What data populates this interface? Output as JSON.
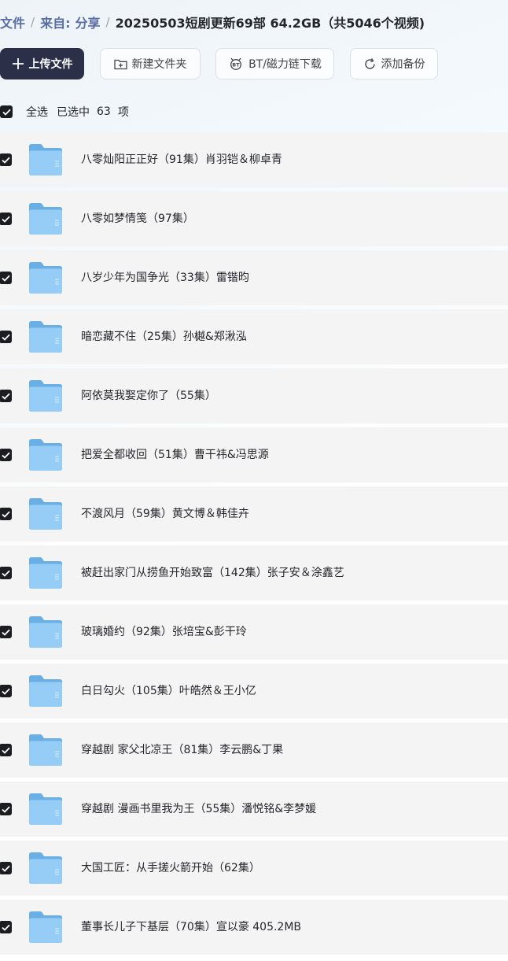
{
  "breadcrumb": {
    "items": [
      "文件",
      "来自:",
      "分享"
    ],
    "separator": "/",
    "current": "20250503短剧更新69部 64.2GB（共5046个视频)"
  },
  "toolbar": {
    "upload_label": "上传文件",
    "new_folder_label": "新建文件夹",
    "bt_label": "BT/磁力链下载",
    "backup_label": "添加备份"
  },
  "selection": {
    "select_all_label": "全选",
    "selected_text": "已选中",
    "selected_count": "63",
    "selected_unit": "项"
  },
  "files": [
    {
      "name": "八零灿阳正正好（91集）肖羽铠＆柳卓青"
    },
    {
      "name": "八零如梦情笺（97集）"
    },
    {
      "name": "八岁少年为国争光（33集）雷锴昀"
    },
    {
      "name": "暗恋藏不住（25集）孙樾&郑湫泓"
    },
    {
      "name": "阿依莫我娶定你了（55集）"
    },
    {
      "name": "把爱全都收回（51集）曹干祎&冯思源"
    },
    {
      "name": "不渡风月（59集）黄文博＆韩佳卉"
    },
    {
      "name": "被赶出家门从捞鱼开始致富（142集）张子安＆涂鑫艺"
    },
    {
      "name": "玻璃婚约（92集）张培宝&彭干玲"
    },
    {
      "name": "白日勾火（105集）叶皓然＆王小亿"
    },
    {
      "name": "穿越剧 家父北凉王（81集）李云鹏&丁果"
    },
    {
      "name": "穿越剧 漫画书里我为王（55集）潘悦铭&李梦媛"
    },
    {
      "name": "大国工匠：从手搓火箭开始（62集）"
    },
    {
      "name": "董事长儿子下基层（70集）宣以豪 405.2MB"
    }
  ],
  "colors": {
    "primary_button": "#2b2f48",
    "breadcrumb_link": "#5a6ea5",
    "row_background": "#f4f4f5",
    "folder": "#6fb6ee",
    "checkbox": "#1c1d20"
  }
}
